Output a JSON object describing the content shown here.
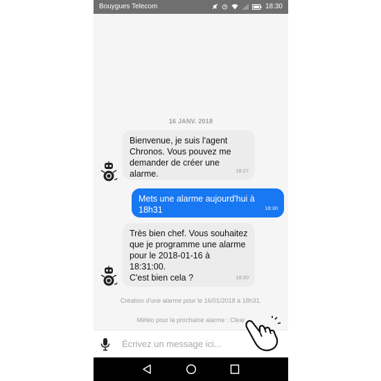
{
  "status_bar": {
    "carrier": "Bouygues Telecom",
    "time": "18:30",
    "icons": [
      "mute-icon",
      "alarm-icon",
      "wifi-icon",
      "signal-icon",
      "battery-icon"
    ]
  },
  "chat": {
    "date_separator": "16 JANV. 2018",
    "messages": [
      {
        "sender": "bot",
        "text": "Bienvenue, je suis l'agent\nChronos. Vous pouvez me\ndemander de créer une alarme.",
        "time": "18:27"
      },
      {
        "sender": "user",
        "text": "Mets une alarme aujourd'hui à 18h31",
        "time": "18:30"
      },
      {
        "sender": "bot",
        "text": "Très bien chef. Vous souhaitez\nque je programme une alarme\npour le 2018-01-16 à 18:31:00.\nC'est bien cela ?",
        "time": "18:30"
      }
    ],
    "info_lines": [
      "Création d'une alarme pour le 16/01/2018 à 18h31.",
      "Météo pour la prochaine alarme : Clear"
    ]
  },
  "input": {
    "placeholder": "Écrivez un message ici..."
  },
  "colors": {
    "status_bar_bg": "#6f6f6f",
    "bot_bubble": "#ececec",
    "user_bubble": "#1877f2",
    "nav_bar_bg": "#000000"
  }
}
